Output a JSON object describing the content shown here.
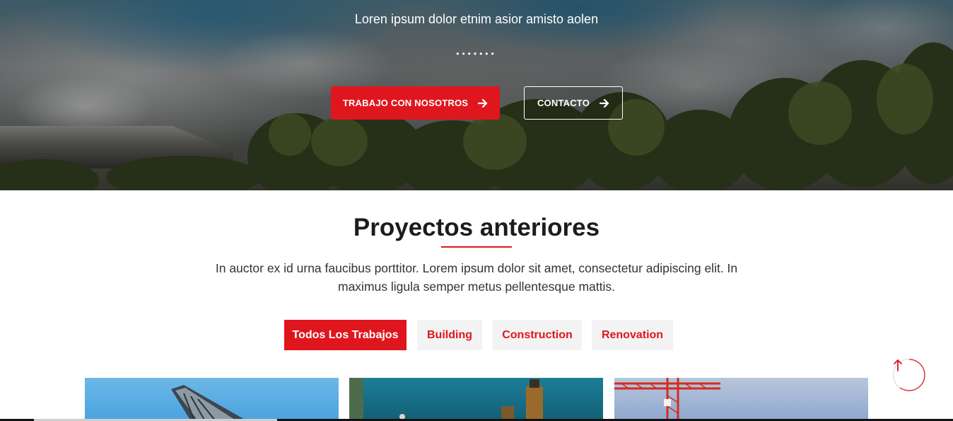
{
  "hero": {
    "subtitle": "Loren ipsum dolor etnim asior amisto aolen",
    "dots": "•••••••",
    "primary_button": "TRABAJO CON NOSOTROS",
    "secondary_button": "CONTACTO"
  },
  "projects": {
    "title": "Proyectos anteriores",
    "description": "In auctor ex id urna faucibus porttitor. Lorem ipsum dolor sit amet, consectetur adipiscing elit. In maximus ligula semper metus pellentesque mattis.",
    "filters": [
      {
        "label": "Todos Los Trabajos",
        "active": true
      },
      {
        "label": "Building",
        "active": false
      },
      {
        "label": "Construction",
        "active": false
      },
      {
        "label": "Renovation",
        "active": false
      }
    ]
  },
  "colors": {
    "accent": "#e0161e",
    "filter_bg": "#f3f3f3",
    "heading": "#1c1c1c"
  },
  "icons": {
    "button_arrow": "arrow-right-icon",
    "scroll_top": "arrow-up-icon"
  }
}
